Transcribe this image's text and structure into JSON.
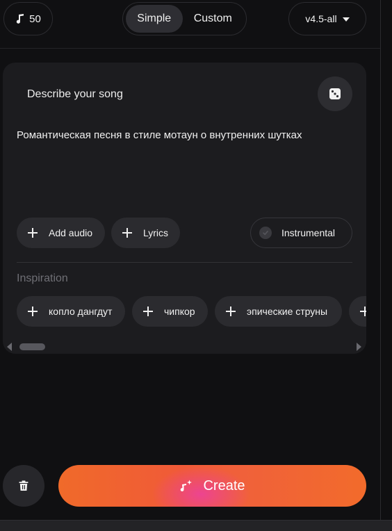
{
  "header": {
    "credits": "50",
    "credits_icon": "music-note-icon",
    "mode_tabs": [
      {
        "label": "Simple",
        "active": true
      },
      {
        "label": "Custom",
        "active": false
      }
    ],
    "model": "v4.5-all"
  },
  "prompt_card": {
    "title": "Describe your song",
    "dice_icon": "dice-icon",
    "prompt_text": "Романтическая песня в стиле мотаун о внутренних шутках",
    "add_audio_label": "Add audio",
    "lyrics_label": "Lyrics",
    "instrumental_label": "Instrumental",
    "instrumental_checked": false
  },
  "inspiration": {
    "label": "Inspiration",
    "chips": [
      "копло дангдут",
      "чипкор",
      "эпические струны",
      ""
    ]
  },
  "footer": {
    "trash_icon": "trash-icon",
    "create_label": "Create",
    "create_icon": "music-sparkle-icon"
  },
  "colors": {
    "background": "#101012",
    "card": "#1c1c1f",
    "pill": "#2b2b2f",
    "create_orange": "#f06a2a",
    "create_pink": "#ec40a0"
  }
}
